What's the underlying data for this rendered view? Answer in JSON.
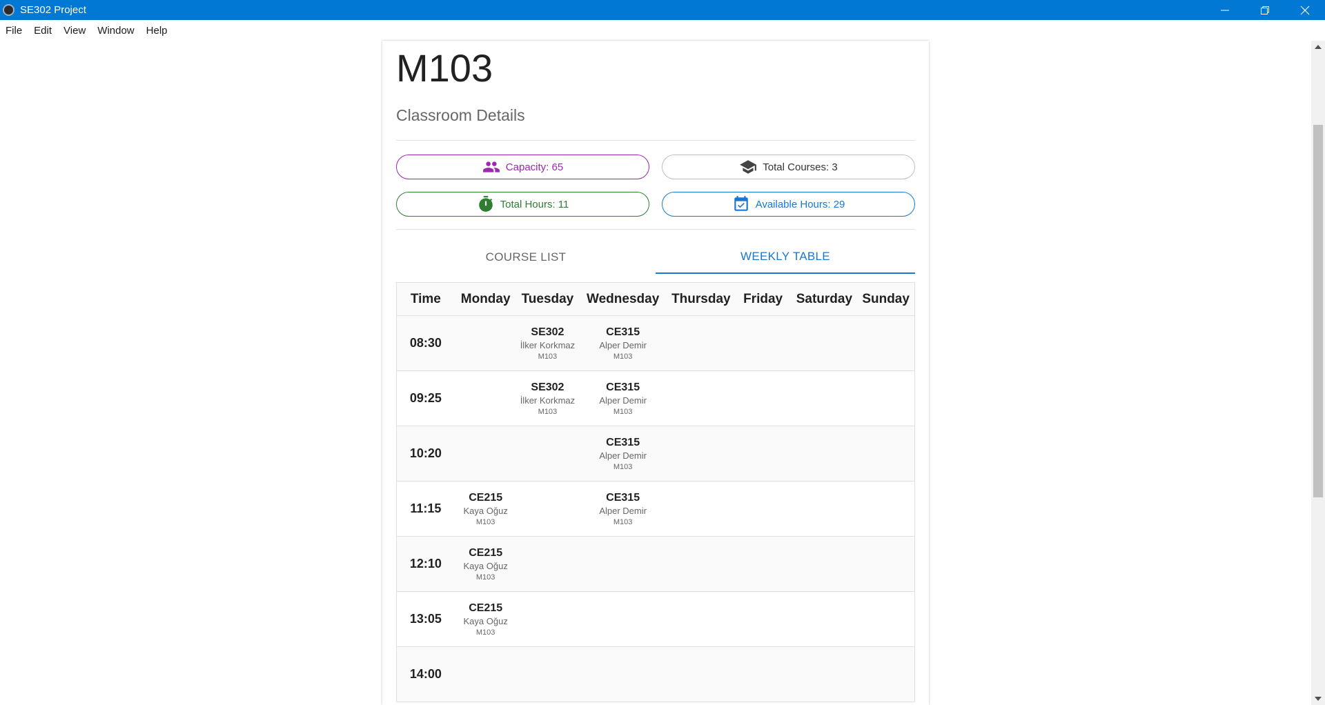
{
  "window": {
    "title": "SE302 Project"
  },
  "menu": [
    "File",
    "Edit",
    "View",
    "Window",
    "Help"
  ],
  "classroom": {
    "name": "M103",
    "subtitle": "Classroom Details",
    "stats": {
      "capacity": "Capacity: 65",
      "total_courses": "Total Courses: 3",
      "total_hours": "Total Hours: 11",
      "available_hours": "Available Hours: 29"
    }
  },
  "tabs": [
    "COURSE LIST",
    "WEEKLY TABLE"
  ],
  "active_tab": "WEEKLY TABLE",
  "colors": {
    "accent": "#1976d2",
    "capacity": "#9c27b0",
    "hours": "#2e7d32",
    "titlebar": "#0078d4"
  },
  "icons": {
    "capacity": "people-icon",
    "courses": "graduation-cap-icon",
    "hours": "timer-icon",
    "available": "calendar-check-icon"
  },
  "schedule": {
    "headers": [
      "Time",
      "Monday",
      "Tuesday",
      "Wednesday",
      "Thursday",
      "Friday",
      "Saturday",
      "Sunday"
    ],
    "rows": [
      {
        "time": "08:30",
        "cells": [
          null,
          {
            "code": "SE302",
            "instructor": "İlker Korkmaz",
            "room": "M103"
          },
          {
            "code": "CE315",
            "instructor": "Alper Demir",
            "room": "M103"
          },
          null,
          null,
          null,
          null
        ]
      },
      {
        "time": "09:25",
        "cells": [
          null,
          {
            "code": "SE302",
            "instructor": "İlker Korkmaz",
            "room": "M103"
          },
          {
            "code": "CE315",
            "instructor": "Alper Demir",
            "room": "M103"
          },
          null,
          null,
          null,
          null
        ]
      },
      {
        "time": "10:20",
        "cells": [
          null,
          null,
          {
            "code": "CE315",
            "instructor": "Alper Demir",
            "room": "M103"
          },
          null,
          null,
          null,
          null
        ]
      },
      {
        "time": "11:15",
        "cells": [
          {
            "code": "CE215",
            "instructor": "Kaya Oğuz",
            "room": "M103"
          },
          null,
          {
            "code": "CE315",
            "instructor": "Alper Demir",
            "room": "M103"
          },
          null,
          null,
          null,
          null
        ]
      },
      {
        "time": "12:10",
        "cells": [
          {
            "code": "CE215",
            "instructor": "Kaya Oğuz",
            "room": "M103"
          },
          null,
          null,
          null,
          null,
          null,
          null
        ]
      },
      {
        "time": "13:05",
        "cells": [
          {
            "code": "CE215",
            "instructor": "Kaya Oğuz",
            "room": "M103"
          },
          null,
          null,
          null,
          null,
          null,
          null
        ]
      },
      {
        "time": "14:00",
        "cells": [
          null,
          null,
          null,
          null,
          null,
          null,
          null
        ]
      }
    ]
  }
}
